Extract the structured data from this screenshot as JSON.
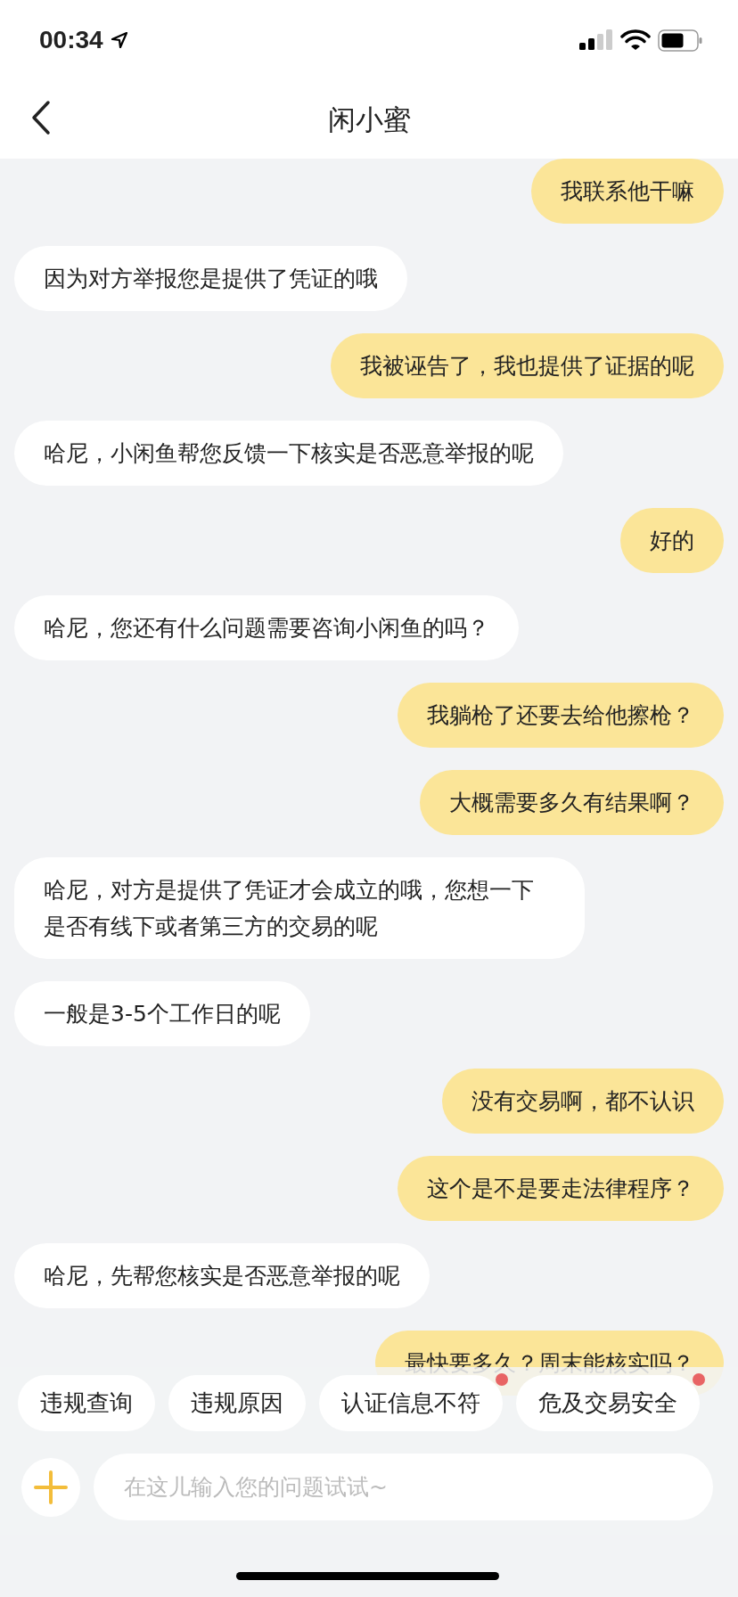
{
  "status_bar": {
    "time": "00:34"
  },
  "header": {
    "title": "闲小蜜"
  },
  "messages": [
    {
      "kind": "sent",
      "text": "我联系他干嘛"
    },
    {
      "kind": "received",
      "text": "因为对方举报您是提供了凭证的哦"
    },
    {
      "kind": "sent",
      "text": "我被诬告了，我也提供了证据的呢"
    },
    {
      "kind": "received",
      "text": "哈尼，小闲鱼帮您反馈一下核实是否恶意举报的呢"
    },
    {
      "kind": "sent",
      "text": "好的"
    },
    {
      "kind": "received",
      "text": "哈尼，您还有什么问题需要咨询小闲鱼的吗？"
    },
    {
      "kind": "sent",
      "text": "我躺枪了还要去给他擦枪？"
    },
    {
      "kind": "sent",
      "text": "大概需要多久有结果啊？"
    },
    {
      "kind": "received",
      "text": "哈尼，对方是提供了凭证才会成立的哦，您想一下是否有线下或者第三方的交易的呢"
    },
    {
      "kind": "received",
      "text": "一般是3-5个工作日的呢"
    },
    {
      "kind": "sent",
      "text": "没有交易啊，都不认识"
    },
    {
      "kind": "sent",
      "text": "这个是不是要走法律程序？"
    },
    {
      "kind": "received",
      "text": "哈尼，先帮您核实是否恶意举报的呢"
    },
    {
      "kind": "sent",
      "text": "最快要多久？周末能核实吗？"
    }
  ],
  "quick_replies": [
    {
      "label": "违规查询",
      "new": false
    },
    {
      "label": "违规原因",
      "new": false
    },
    {
      "label": "认证信息不符",
      "new": true
    },
    {
      "label": "危及交易安全",
      "new": true
    }
  ],
  "input": {
    "placeholder": "在这儿输入您的问题试试~"
  }
}
